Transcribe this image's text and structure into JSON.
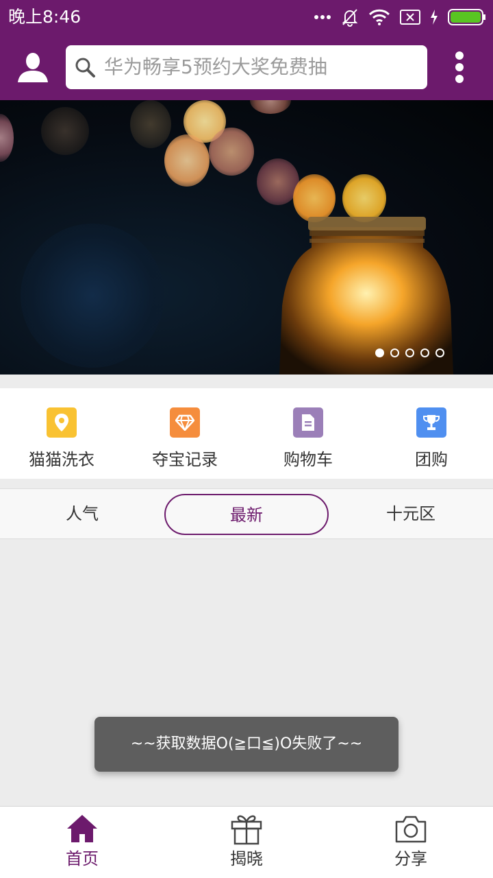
{
  "status_bar": {
    "time": "晚上8:46"
  },
  "header": {
    "search_placeholder": "华为畅享5预约大奖免费抽"
  },
  "banner": {
    "slide_count": 5,
    "active_slide": 1
  },
  "quick_menu": [
    {
      "label": "猫猫洗衣",
      "icon": "location-pin-icon",
      "color": "#f9c232"
    },
    {
      "label": "夺宝记录",
      "icon": "diamond-icon",
      "color": "#f58d3d"
    },
    {
      "label": "购物车",
      "icon": "document-icon",
      "color": "#9b7fb8"
    },
    {
      "label": "团购",
      "icon": "trophy-icon",
      "color": "#4f8ff0"
    }
  ],
  "tabs": [
    {
      "label": "人气"
    },
    {
      "label": "最新",
      "active": true
    },
    {
      "label": "十元区"
    }
  ],
  "toast": {
    "message": "~~获取数据O(≧口≦)O失败了~~"
  },
  "bottom_nav": [
    {
      "label": "首页",
      "icon": "home-icon",
      "active": true
    },
    {
      "label": "揭晓",
      "icon": "gift-icon"
    },
    {
      "label": "分享",
      "icon": "camera-icon"
    }
  ],
  "colors": {
    "brand": "#6c1a6c",
    "background": "#ececec"
  }
}
